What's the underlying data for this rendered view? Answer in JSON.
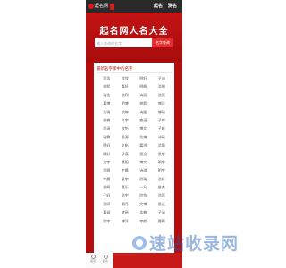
{
  "header": {
    "logo_text": "起名网",
    "nav": [
      "起名",
      "测名"
    ]
  },
  "hero": {
    "title": "起名网人名大全",
    "search_placeholder": "输入查询的名字",
    "search_button": "名字查询"
  },
  "card": {
    "title": "最新名字库中的名字",
    "names": [
      "思浩",
      "欣欣",
      "明轩",
      "子川",
      "俊熙",
      "嘉轩",
      "明辉",
      "浩阳",
      "瑞浩",
      "浩翔",
      "诗辰",
      "浩然",
      "嘉博",
      "明博",
      "俊熙",
      "博洋",
      "浩瑞",
      "欣婷",
      "诗媛",
      "博瑞",
      "俊楠",
      "文宇",
      "睿涵",
      "子婷",
      "思涵",
      "欣怡",
      "博文",
      "子媛",
      "瑞霖",
      "思源",
      "浩博",
      "诗瑶",
      "明轩",
      "文彬",
      "嘉鸿",
      "浩莉",
      "明轩",
      "子豪",
      "思远",
      "思宇",
      "浩宇",
      "晨阳",
      "博文",
      "明宇",
      "思雅",
      "宇晨",
      "诗琪",
      "明宇",
      "宇晨",
      "星宇",
      "欣瑞",
      "浩轩",
      "俊辉",
      "嘉乐",
      "一凡",
      "俊杰",
      "子轩",
      "浩宇",
      "欣怡",
      "浩然",
      "思妍",
      "明月",
      "文博",
      "思远",
      "嘉诚",
      "梦瑶",
      "浩楠",
      "子涵",
      "欣宇",
      "博洋",
      "宇航",
      "晨曦"
    ]
  },
  "bottom_bar": [
    "首页",
    "起名"
  ],
  "watermark": {
    "text": "速站收录网"
  }
}
